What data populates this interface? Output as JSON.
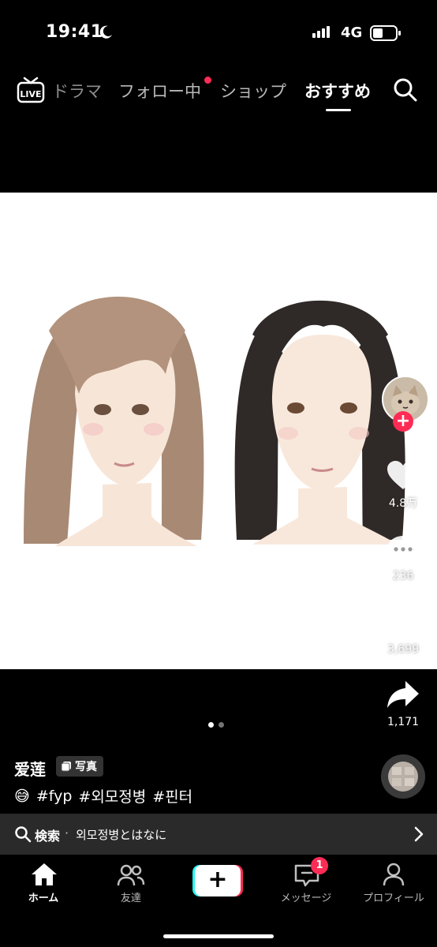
{
  "status_bar": {
    "time": "19:41",
    "network": "4G"
  },
  "top_nav": {
    "tabs": [
      {
        "label": "ドラマ"
      },
      {
        "label": "フォロー中"
      },
      {
        "label": "ショップ"
      },
      {
        "label": "おすすめ",
        "active": true
      }
    ]
  },
  "post": {
    "like_count": "4.8万",
    "comment_count": "236",
    "bookmark_count": "3,699",
    "share_count": "1,171",
    "username": "爱莲",
    "badge_label": "写真",
    "caption_emoji": "😅",
    "hashtags": [
      "#fyp",
      "#외모정병",
      "#핀터"
    ]
  },
  "search_bar": {
    "label": "検索",
    "separator": "·",
    "query": "외모정병とはなに"
  },
  "bottom_nav": {
    "items": [
      {
        "label": "ホーム",
        "icon": "home-icon",
        "active": true
      },
      {
        "label": "友達",
        "icon": "friends-icon"
      },
      {
        "label": "",
        "icon": "create-icon"
      },
      {
        "label": "メッセージ",
        "icon": "message-icon",
        "badge": "1"
      },
      {
        "label": "プロフィール",
        "icon": "profile-icon"
      }
    ]
  },
  "colors": {
    "accent": "#fe2c55",
    "cyan": "#25f4ee",
    "background": "#000000"
  }
}
